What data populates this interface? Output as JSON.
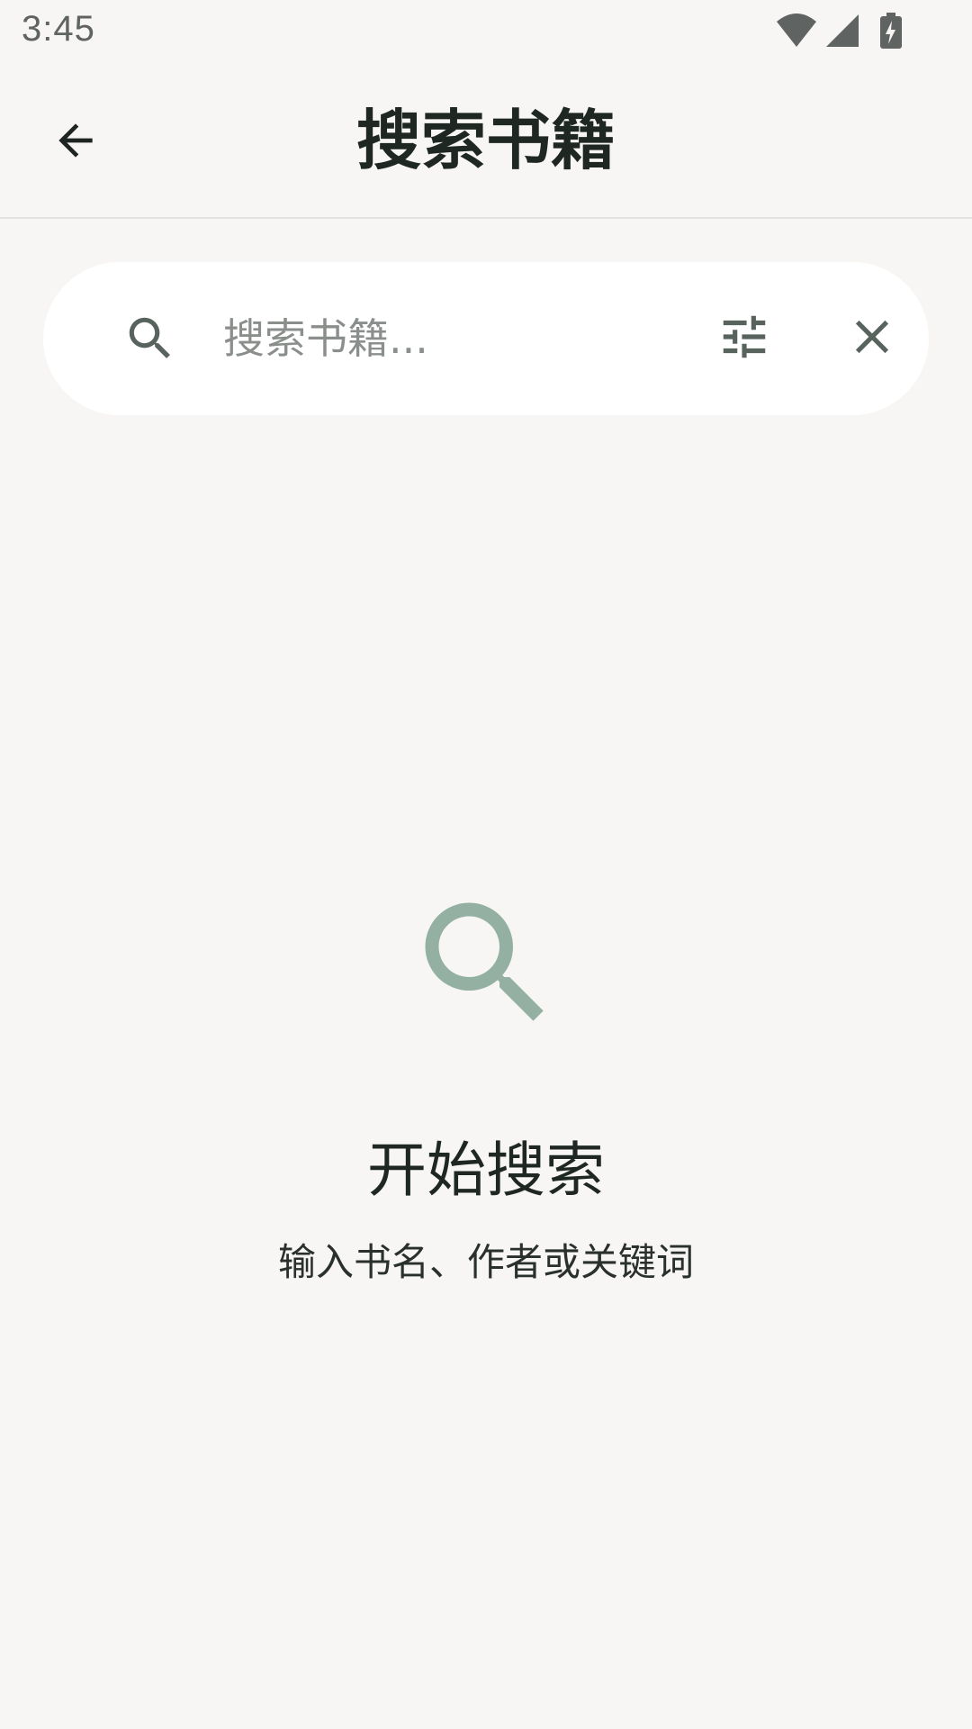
{
  "status_bar": {
    "time": "3:45",
    "icons": [
      "wifi-icon",
      "signal-icon",
      "battery-charging-icon"
    ]
  },
  "app_bar": {
    "back_icon": "arrow-back-icon",
    "title": "搜索书籍"
  },
  "search": {
    "placeholder": "搜索书籍...",
    "value": "",
    "search_icon": "search-icon",
    "filter_icon": "tune-icon",
    "clear_icon": "close-icon"
  },
  "empty_state": {
    "icon": "search-icon",
    "title": "开始搜索",
    "subtitle": "输入书名、作者或关键词"
  },
  "colors": {
    "background": "#f7f6f4",
    "surface": "#ffffff",
    "accent_muted": "#93b0a2",
    "icon_gray": "#58635e"
  }
}
